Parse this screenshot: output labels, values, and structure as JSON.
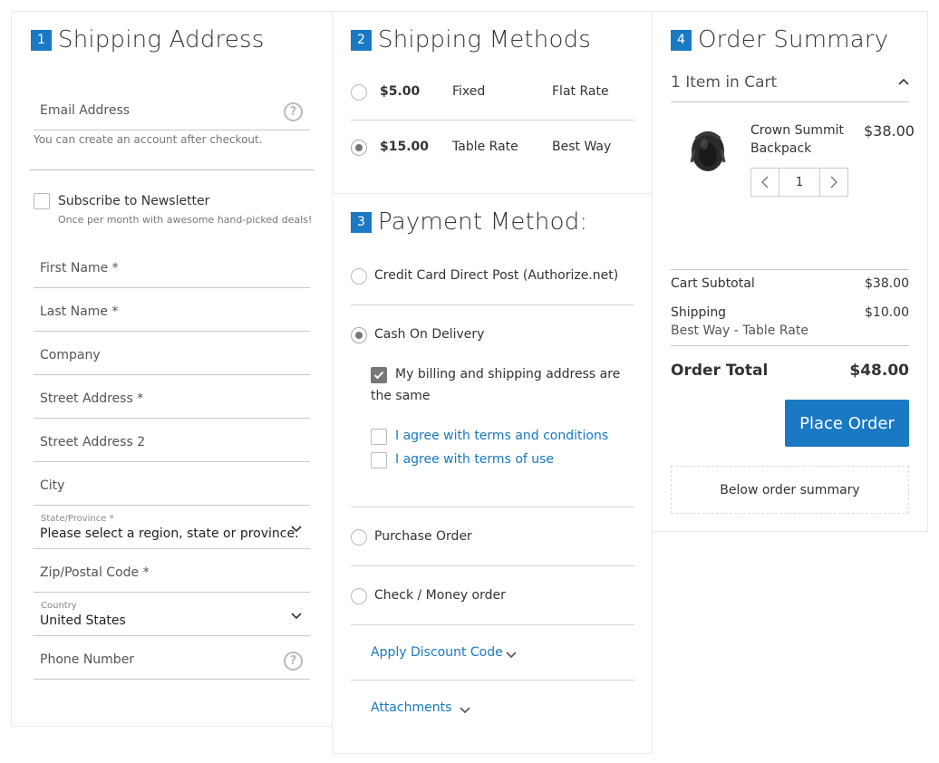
{
  "shipping_address": {
    "step": "1",
    "title": "Shipping Address",
    "email_label": "Email Address",
    "email_hint": "You can create an account after checkout.",
    "newsletter_label": "Subscribe to Newsletter",
    "newsletter_hint": "Once per month with awesome hand-picked deals!",
    "first_name": "First Name *",
    "last_name": "Last Name *",
    "company": "Company",
    "street1": "Street Address *",
    "street2": "Street Address 2",
    "city": "City",
    "state_label": "State/Province *",
    "state_value": "Please select a region, state or province.",
    "zip": "Zip/Postal Code *",
    "country_label": "Country",
    "country_value": "United States",
    "phone": "Phone Number",
    "help_glyph": "?"
  },
  "shipping_methods": {
    "step": "2",
    "title": "Shipping Methods",
    "options": [
      {
        "price": "$5.00",
        "method": "Fixed",
        "carrier": "Flat Rate",
        "selected": false
      },
      {
        "price": "$15.00",
        "method": "Table Rate",
        "carrier": "Best Way",
        "selected": true
      }
    ]
  },
  "payment_method": {
    "step": "3",
    "title": "Payment Method:",
    "credit_card": "Credit Card Direct Post (Authorize.net)",
    "cash_on_delivery": "Cash On Delivery",
    "same_address": "My billing and shipping address are the same",
    "same_address_line1": "My billing and shipping address are",
    "same_address_line2": "the same",
    "terms_conditions": "I agree with terms and conditions",
    "terms_of_use": "I agree with terms of use",
    "purchase_order": "Purchase Order",
    "check_money": "Check / Money order",
    "discount": "Apply Discount Code",
    "attachments": "Attachments"
  },
  "order_summary": {
    "step": "4",
    "title": "Order Summary",
    "items_in_cart": "1 Item in Cart",
    "product_name_line1": "Crown Summit",
    "product_name_line2": "Backpack",
    "product_price": "$38.00",
    "qty": "1",
    "subtotal_label": "Cart Subtotal",
    "subtotal_value": "$38.00",
    "shipping_label": "Shipping",
    "shipping_value": "$10.00",
    "shipping_method": "Best Way - Table Rate",
    "total_label": "Order Total",
    "total_value": "$48.00",
    "place_order": "Place Order",
    "below_summary": "Below order summary"
  },
  "colors": {
    "accent": "#1979c3",
    "text": "#333333",
    "checkbox_checked": "#777777"
  }
}
